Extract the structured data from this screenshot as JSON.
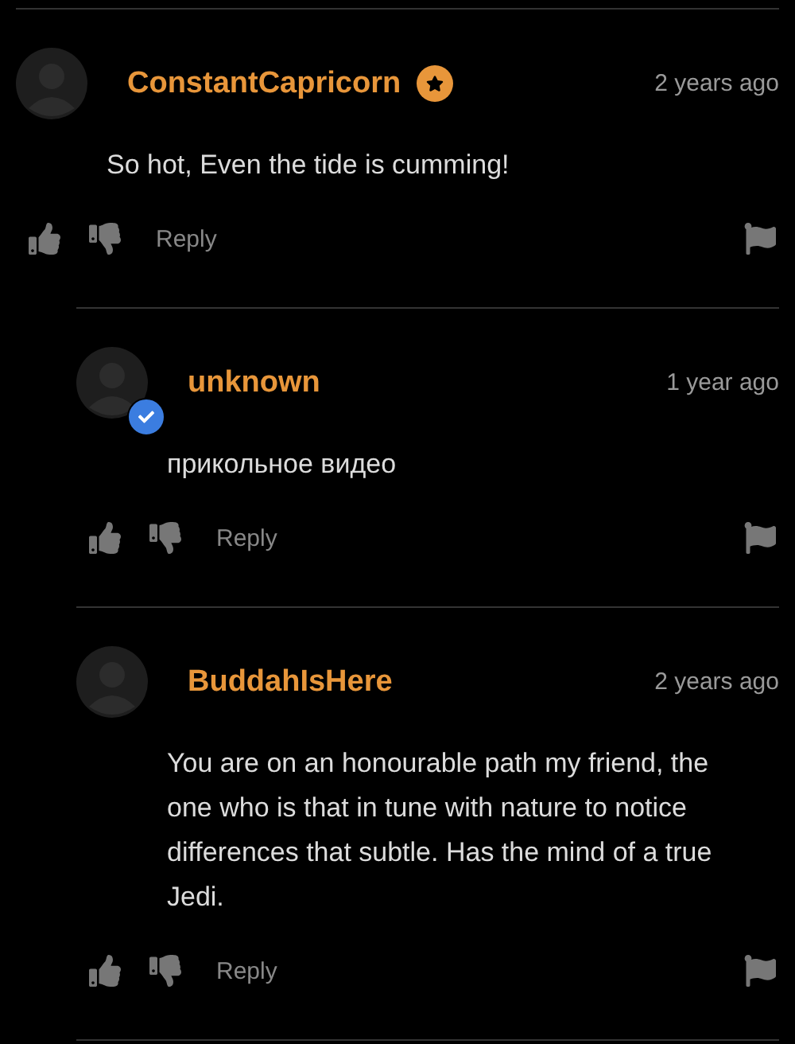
{
  "comments": [
    {
      "author": "ConstantCapricorn",
      "badge": {
        "kind": "star"
      },
      "time": "2 years ago",
      "text": "So hot, Even the tide is cumming!",
      "reply": "Reply",
      "children": [
        {
          "author": "unknown",
          "badge": {
            "kind": "verified"
          },
          "time": "1 year ago",
          "text": "прикольное видео",
          "reply": "Reply"
        },
        {
          "author": "BuddahIsHere",
          "time": "2 years ago",
          "text": "You are on an honourable path my friend, the one who is that in tune with nature to notice differences that subtle. Has the mind of a true Jedi.",
          "reply": "Reply"
        }
      ]
    }
  ]
}
